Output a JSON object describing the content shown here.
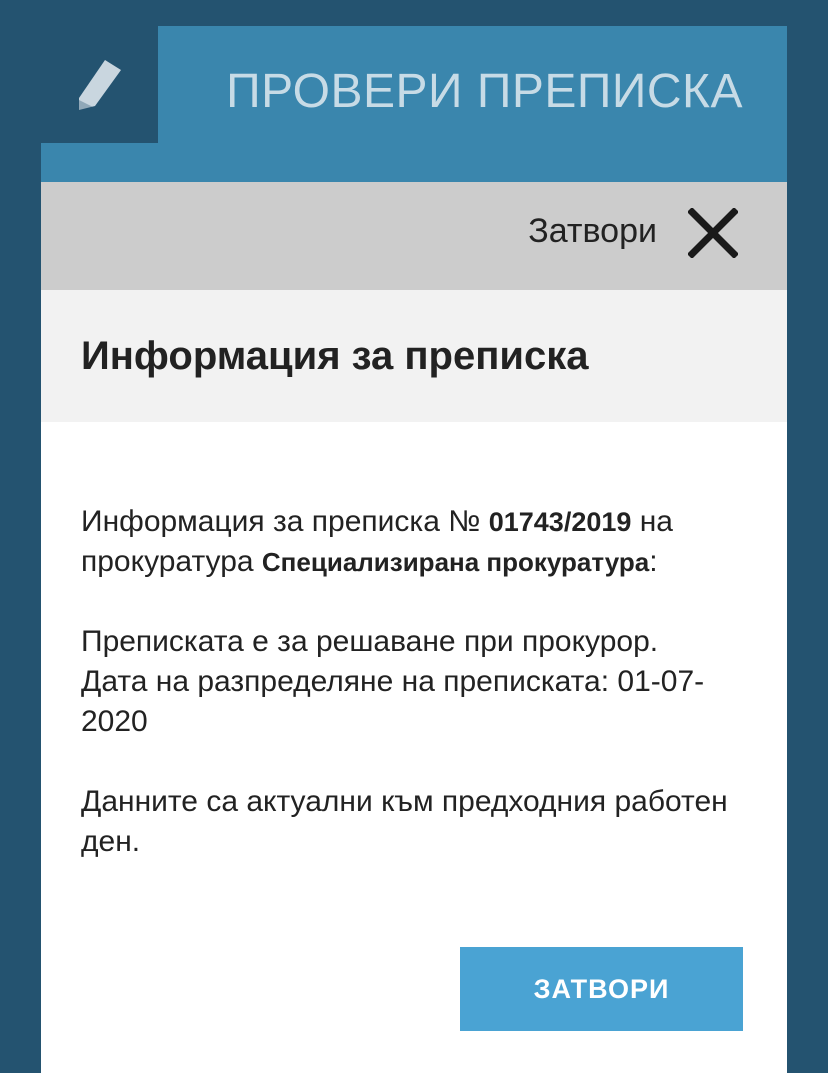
{
  "header": {
    "title": "ПРОВЕРИ ПРЕПИСКА",
    "icon": "pencil-icon"
  },
  "close_bar": {
    "label": "Затвори",
    "icon": "close-icon"
  },
  "modal": {
    "title": "Информация за преписка",
    "intro_prefix": "Информация за преписка №",
    "case_number": "01743/2019",
    "intro_middle": "на прокуратура",
    "prosecution": "Специализирана прокуратура",
    "intro_suffix": ":",
    "status_line": "Преписката е за решаване при прокурор.",
    "date_label": "Дата на разпределяне на преписката:",
    "date_value": "01-07-2020",
    "data_note": "Данните са актуални към предходния работен ден.",
    "button_label": "ЗАТВОРИ"
  },
  "colors": {
    "background": "#245370",
    "header": "#3a86ad",
    "close_bar": "#cccccc",
    "button": "#4aa3d3"
  }
}
